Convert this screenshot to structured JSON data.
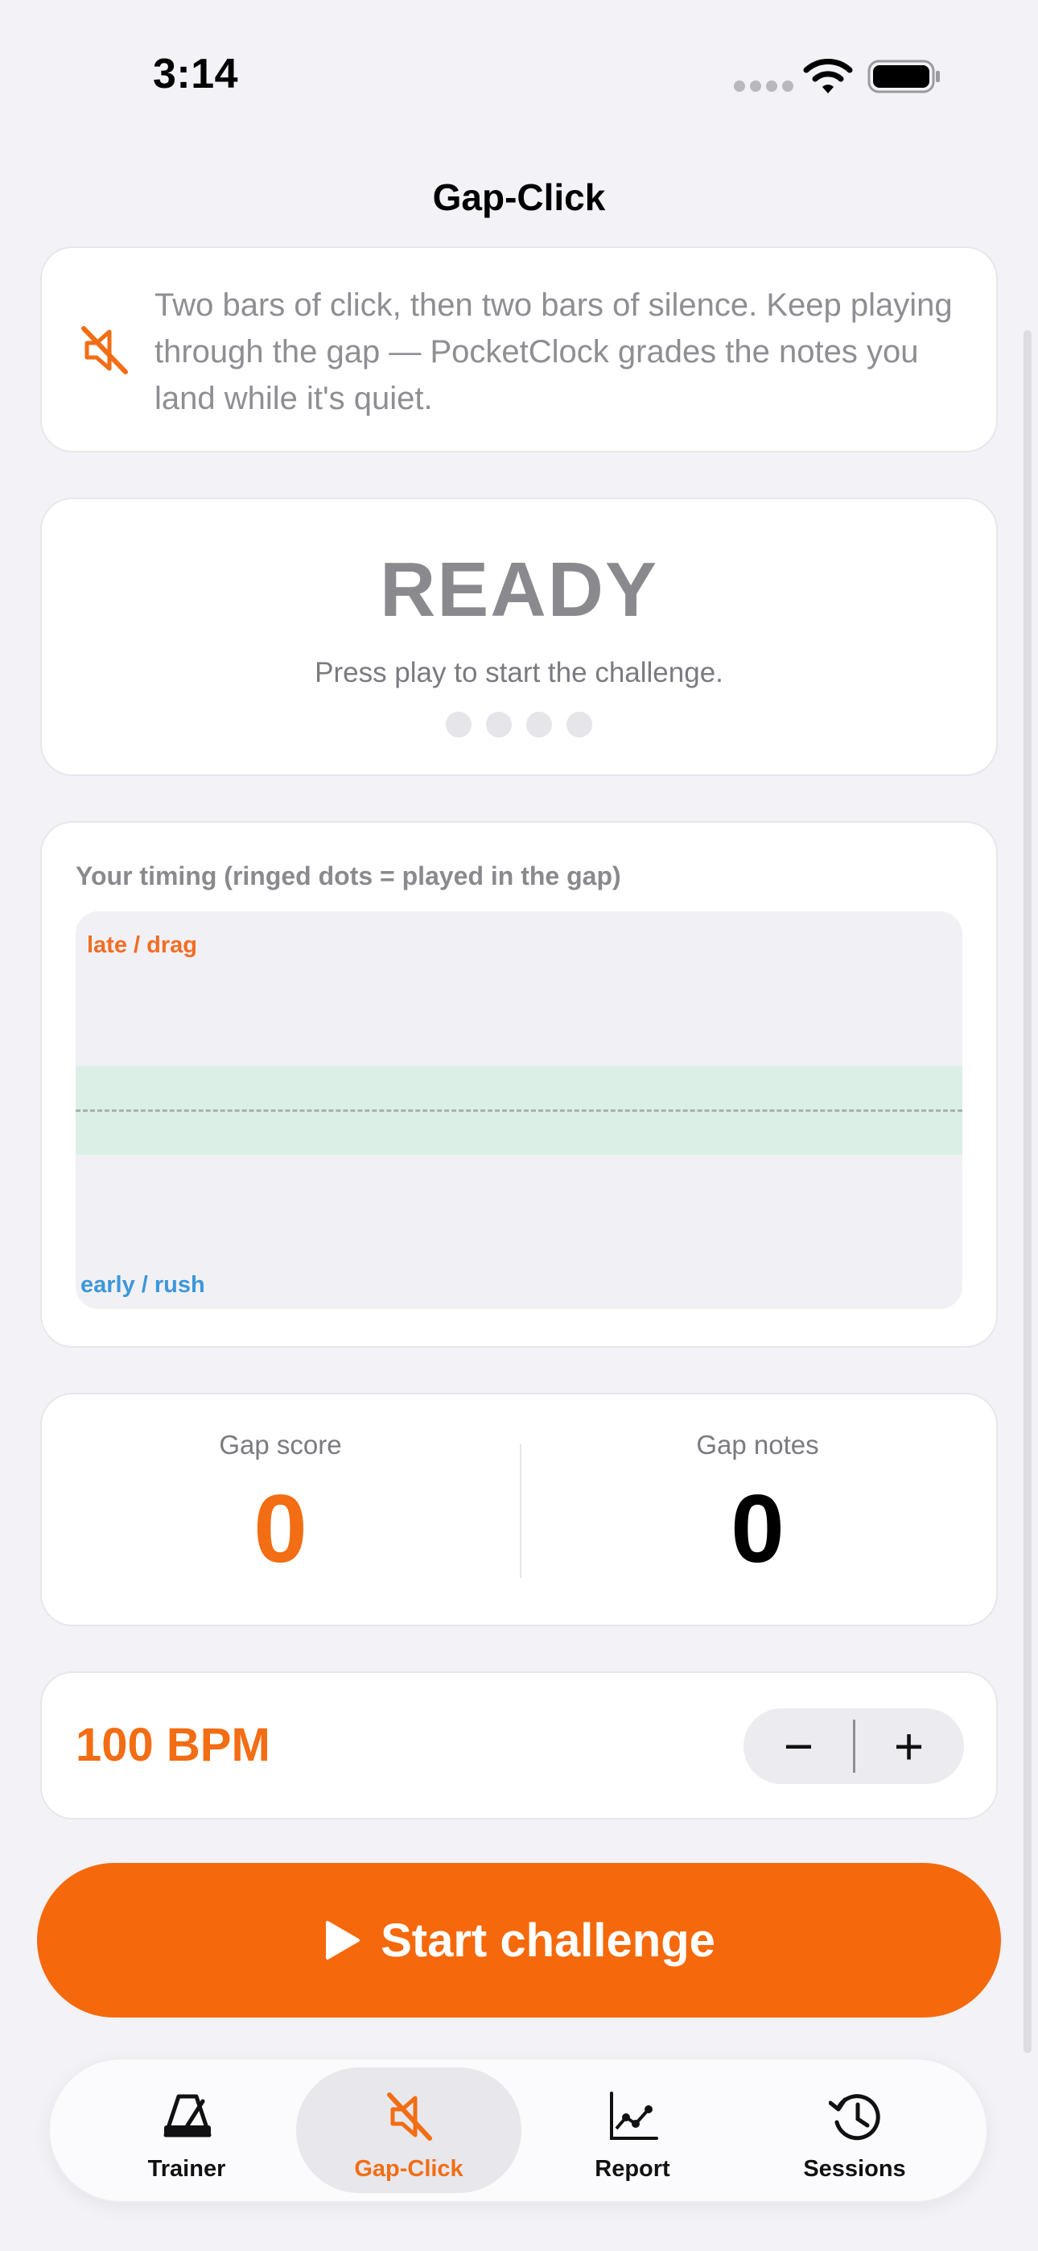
{
  "status_bar": {
    "time": "3:14"
  },
  "nav": {
    "title": "Gap-Click"
  },
  "info": {
    "icon": "speaker-muted-icon",
    "text": "Two bars of click, then two bars of silence. Keep playing through the gap — PocketClock grades the notes you land while it's quiet."
  },
  "status": {
    "title": "READY",
    "subtitle": "Press play to start the challenge.",
    "beats_total": 4,
    "beats_active": 0
  },
  "timing": {
    "heading": "Your timing (ringed dots = played in the gap)",
    "late_label": "late / drag",
    "early_label": "early / rush"
  },
  "scores": {
    "gap_score_label": "Gap score",
    "gap_score_value": "0",
    "gap_notes_label": "Gap notes",
    "gap_notes_value": "0"
  },
  "tempo": {
    "bpm_label": "100 BPM",
    "decrement": "−",
    "increment": "+"
  },
  "start_button": {
    "label": "Start challenge",
    "icon": "play-icon"
  },
  "tabs": [
    {
      "label": "Trainer",
      "icon": "metronome-icon",
      "active": false
    },
    {
      "label": "Gap-Click",
      "icon": "speaker-muted-icon",
      "active": true
    },
    {
      "label": "Report",
      "icon": "line-chart-icon",
      "active": false
    },
    {
      "label": "Sessions",
      "icon": "history-clock-icon",
      "active": false
    }
  ],
  "colors": {
    "accent": "#f5690c",
    "late": "#f26d24",
    "early": "#3d97da",
    "target_band": "#dcefe6",
    "background": "#f2f2f7"
  }
}
